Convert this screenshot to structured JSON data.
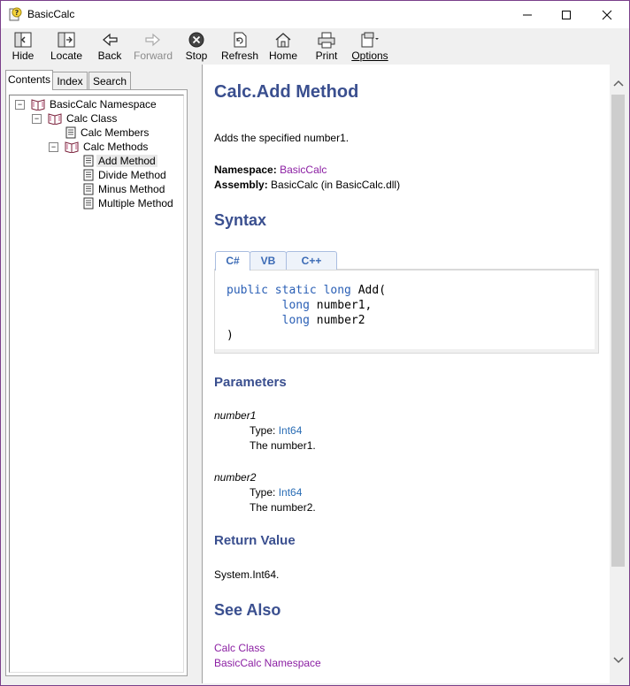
{
  "window": {
    "title": "BasicCalc"
  },
  "toolbar": {
    "buttons": [
      {
        "label": "Hide"
      },
      {
        "label": "Locate"
      },
      {
        "label": "Back"
      },
      {
        "label": "Forward"
      },
      {
        "label": "Stop"
      },
      {
        "label": "Refresh"
      },
      {
        "label": "Home"
      },
      {
        "label": "Print"
      },
      {
        "label": "Options"
      }
    ]
  },
  "nav_tabs": [
    "Contents",
    "Index",
    "Search"
  ],
  "tree": [
    {
      "label": "BasicCalc Namespace",
      "icon": "book-icon",
      "toggle": "⊟"
    },
    {
      "label": "Calc Class",
      "icon": "book-icon",
      "toggle": "⊟"
    },
    {
      "label": "Calc Members",
      "icon": "page-icon"
    },
    {
      "label": "Calc Methods",
      "icon": "book-icon",
      "toggle": "⊟"
    },
    {
      "label": "Add Method",
      "icon": "page-icon",
      "selected": true
    },
    {
      "label": "Divide Method",
      "icon": "page-icon"
    },
    {
      "label": "Minus Method",
      "icon": "page-icon"
    },
    {
      "label": "Multiple Method",
      "icon": "page-icon"
    }
  ],
  "doc": {
    "title": "Calc.Add Method",
    "summary": "Adds the specified number1.",
    "namespace_label": "Namespace:",
    "namespace_value": "BasicCalc",
    "assembly_label": "Assembly:",
    "assembly_value": "BasicCalc (in BasicCalc.dll)",
    "syntax_heading": "Syntax",
    "code_tabs": [
      "C#",
      "VB",
      "C++"
    ],
    "code": {
      "l1_kw": "public static long",
      "l1_rest": " Add(",
      "l2_kw": "long",
      "l2_rest": " number1,",
      "l3_kw": "long",
      "l3_rest": " number2",
      "l4": ")"
    },
    "parameters_heading": "Parameters",
    "params": [
      {
        "name": "number1",
        "type_label": "Type: ",
        "type": "Int64",
        "desc": "The number1."
      },
      {
        "name": "number2",
        "type_label": "Type: ",
        "type": "Int64",
        "desc": "The number2."
      }
    ],
    "return_heading": "Return Value",
    "return_value": "System.Int64.",
    "see_also_heading": "See Also",
    "see_also": [
      "Calc Class",
      "BasicCalc Namespace"
    ]
  },
  "colors": {
    "heading": "#3a4f8f",
    "link": "#8b1fa3",
    "type_link": "#2a6db5",
    "keyword": "#2a5fb5"
  }
}
